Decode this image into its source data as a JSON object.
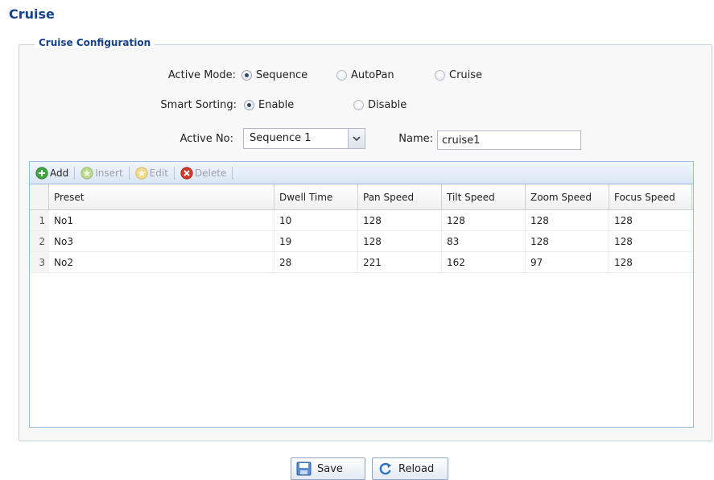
{
  "page": {
    "title": "Cruise"
  },
  "config": {
    "legend": "Cruise Configuration",
    "active_mode": {
      "label": "Active Mode:",
      "options": [
        {
          "label": "Sequence",
          "checked": true
        },
        {
          "label": "AutoPan",
          "checked": false
        },
        {
          "label": "Cruise",
          "checked": false
        }
      ]
    },
    "smart_sorting": {
      "label": "Smart Sorting:",
      "options": [
        {
          "label": "Enable",
          "checked": true
        },
        {
          "label": "Disable",
          "checked": false
        }
      ]
    },
    "active_no": {
      "label": "Active No:",
      "value": "Sequence 1"
    },
    "name": {
      "label": "Name:",
      "value": "cruise1"
    }
  },
  "toolbar": {
    "add": "Add",
    "insert": "Insert",
    "edit": "Edit",
    "delete": "Delete"
  },
  "table": {
    "columns": [
      "Preset",
      "Dwell Time",
      "Pan Speed",
      "Tilt Speed",
      "Zoom Speed",
      "Focus Speed"
    ],
    "rows": [
      {
        "num": "1",
        "preset": "No1",
        "dwell": "10",
        "pan": "128",
        "tilt": "128",
        "zoom": "128",
        "focus": "128"
      },
      {
        "num": "2",
        "preset": "No3",
        "dwell": "19",
        "pan": "128",
        "tilt": "83",
        "zoom": "128",
        "focus": "128"
      },
      {
        "num": "3",
        "preset": "No2",
        "dwell": "28",
        "pan": "221",
        "tilt": "162",
        "zoom": "97",
        "focus": "128"
      }
    ]
  },
  "footer": {
    "save": "Save",
    "reload": "Reload"
  },
  "icons": {
    "add": "add-icon",
    "insert": "insert-icon",
    "edit": "edit-icon",
    "delete": "delete-icon",
    "save": "save-icon",
    "reload": "reload-icon",
    "dropdown": "chevron-down-icon"
  },
  "colors": {
    "title": "#15428b",
    "grid_border": "#99bbe8",
    "add_icon": "#3fa53f",
    "delete_icon": "#d23b2b",
    "edit_icon": "#f1c232"
  }
}
